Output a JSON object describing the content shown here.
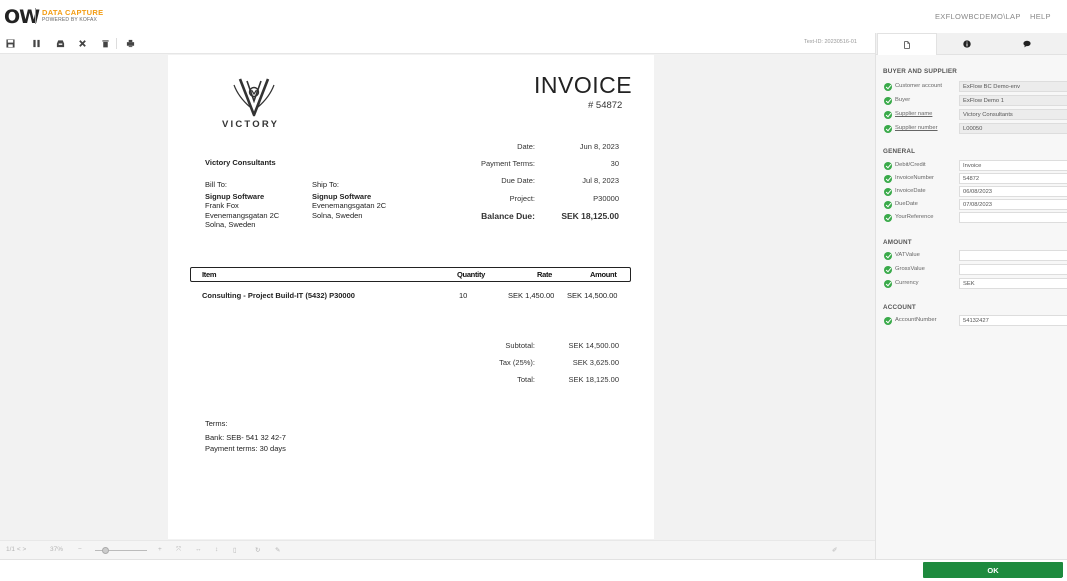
{
  "header": {
    "logo_mark": "OW",
    "brand_title": "DATA CAPTURE",
    "brand_subtitle": "POWERED BY KOFAX",
    "user": "EXFLOWBCDEMO\\LAP",
    "help": "HELP"
  },
  "toolbar": {
    "text_id": "Text-ID: 20230516-01"
  },
  "invoice": {
    "brand": "VICTORY",
    "title": "INVOICE",
    "number": "# 54872",
    "date_label": "Date:",
    "date": "Jun 8, 2023",
    "payment_terms_label": "Payment Terms:",
    "payment_terms": "30",
    "due_date_label": "Due Date:",
    "due_date": "Jul 8, 2023",
    "project_label": "Project:",
    "project": "P30000",
    "balance_label": "Balance Due:",
    "balance": "SEK 18,125.00",
    "from": "Victory Consultants",
    "bill_to_label": "Bill To:",
    "ship_to_label": "Ship To:",
    "bill_to": [
      "Signup Software",
      "Frank Fox",
      "Evenemangsgatan 2C",
      "Solna, Sweden"
    ],
    "ship_to": [
      "Signup Software",
      "Evenemangsgatan 2C",
      "Solna, Sweden"
    ],
    "columns": [
      "Item",
      "Quantity",
      "Rate",
      "Amount"
    ],
    "lines": [
      {
        "item": "Consulting - Project Build-IT (5432) P30000",
        "qty": "10",
        "rate": "SEK 1,450.00",
        "amount": "SEK 14,500.00"
      }
    ],
    "subtotal_label": "Subtotal:",
    "subtotal": "SEK 14,500.00",
    "tax_label": "Tax (25%):",
    "tax": "SEK 3,625.00",
    "total_label": "Total:",
    "total": "SEK 18,125.00",
    "terms_label": "Terms:",
    "terms_bank": "Bank: SEB- 541 32 42-7",
    "terms_payment": "Payment terms: 30 days"
  },
  "bottombar": {
    "page_nav": "1/1 < >",
    "zoom": "37%",
    "zoom_level_percent": 37,
    "zoom_minus": "−",
    "zoom_plus": "+"
  },
  "panel": {
    "sections": [
      {
        "title": "BUYER AND SUPPLIER",
        "fields": [
          {
            "label": "Customer account",
            "value": "ExFlow BC Demo-env",
            "readonly": true,
            "link": false
          },
          {
            "label": "Buyer",
            "value": "ExFlow Demo 1",
            "readonly": true,
            "link": false
          },
          {
            "label": "Supplier name",
            "value": "Victory Consultants",
            "readonly": true,
            "link": true
          },
          {
            "label": "Supplier number",
            "value": "L00050",
            "readonly": true,
            "link": true
          }
        ]
      },
      {
        "title": "GENERAL",
        "fields": [
          {
            "label": "Debit/Credit",
            "value": "Invoice",
            "readonly": false,
            "link": false
          },
          {
            "label": "InvoiceNumber",
            "value": "54872",
            "readonly": false,
            "link": false
          },
          {
            "label": "InvoiceDate",
            "value": "06/08/2023",
            "readonly": false,
            "link": false
          },
          {
            "label": "DueDate",
            "value": "07/08/2023",
            "readonly": false,
            "link": false
          },
          {
            "label": "YourReference",
            "value": "",
            "readonly": false,
            "link": false
          }
        ]
      },
      {
        "title": "AMOUNT",
        "fields": [
          {
            "label": "VATValue",
            "value": "",
            "readonly": false,
            "link": false
          },
          {
            "label": "GrossValue",
            "value": "",
            "readonly": false,
            "link": false
          },
          {
            "label": "Currency",
            "value": "SEK",
            "readonly": false,
            "link": false
          }
        ]
      },
      {
        "title": "ACCOUNT",
        "fields": [
          {
            "label": "AccountNumber",
            "value": "54132427",
            "readonly": false,
            "link": false
          }
        ]
      }
    ]
  },
  "footer": {
    "ok_label": "OK"
  },
  "colors": {
    "accent_orange": "#f39c12",
    "ok_green": "#1e8a3e",
    "check_green": "#3aaa4a"
  }
}
